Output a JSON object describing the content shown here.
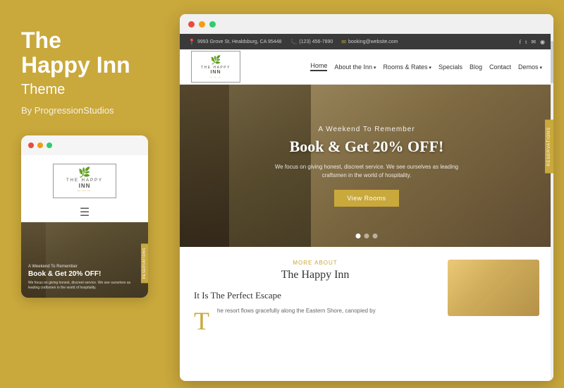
{
  "left_panel": {
    "title_line1": "The",
    "title_line2": "Happy Inn",
    "subtitle": "Theme",
    "by_line": "By ProgressionStudios"
  },
  "mobile": {
    "dots": [
      "red",
      "yellow",
      "green"
    ],
    "logo": {
      "top": "THE HAPPY",
      "main": "INN",
      "sub": "———"
    },
    "hero": {
      "subtitle": "A Weekend To Remember",
      "title": "Book & Get 20% OFF!",
      "desc": "We focus on giving honest, discreet service. We see ourselves as leading craftsmen in the world of hospitality."
    },
    "reservations_label": "RESERVATIONS"
  },
  "desktop": {
    "topbar": {
      "address": "9993 Grove St, Healdsburg, CA 95448",
      "phone": "(123) 456-7890",
      "email": "booking@website.com"
    },
    "nav": {
      "logo": {
        "top": "THE HAPPY",
        "main": "INN",
        "sub": "———"
      },
      "links": [
        {
          "label": "Home",
          "active": true,
          "has_dropdown": false
        },
        {
          "label": "About the Inn",
          "active": false,
          "has_dropdown": true
        },
        {
          "label": "Rooms & Rates",
          "active": false,
          "has_dropdown": true
        },
        {
          "label": "Specials",
          "active": false,
          "has_dropdown": false
        },
        {
          "label": "Blog",
          "active": false,
          "has_dropdown": false
        },
        {
          "label": "Contact",
          "active": false,
          "has_dropdown": false
        },
        {
          "label": "Demos",
          "active": false,
          "has_dropdown": true
        }
      ]
    },
    "hero": {
      "small_title": "A Weekend To Remember",
      "main_title": "Book & Get 20% OFF!",
      "desc": "We focus on giving honest, discreet service. We see ourselves as leading craftsmen in the world of hospitality.",
      "button_label": "View Rooms",
      "reservations_label": "RESERVATIONS",
      "dots": [
        true,
        false,
        false
      ]
    },
    "content": {
      "more_about_label": "MORE ABOUT",
      "section_title": "The Happy Inn",
      "sub_title": "It Is The Perfect Escape",
      "drop_cap": "T",
      "body_text": "he resort flows gracefully along the Eastern Shore, canopied by"
    }
  }
}
